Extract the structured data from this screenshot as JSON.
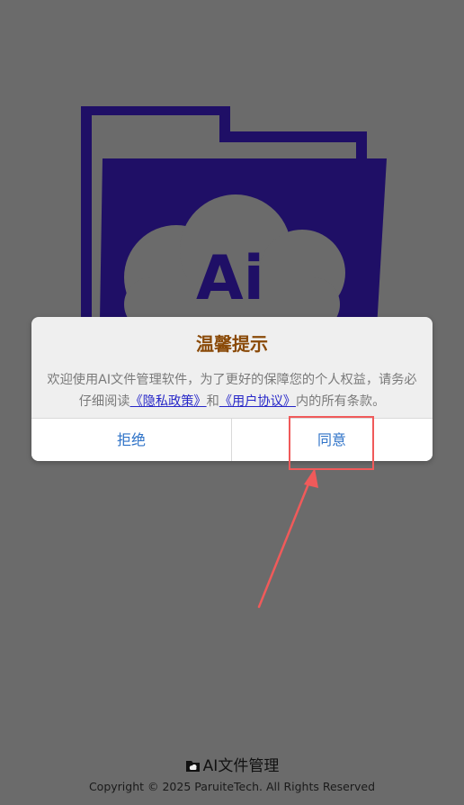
{
  "dialog": {
    "title": "温馨提示",
    "body_prefix": "欢迎使用AI文件管理软件，为了更好的保障您的个人权益，请务必仔细阅读",
    "privacy_link": "《隐私政策》",
    "body_middle": "和",
    "terms_link": "《用户协议》",
    "body_suffix": "内的所有条款。",
    "reject_label": "拒绝",
    "agree_label": "同意"
  },
  "splash": {
    "logo_text": "Ai",
    "logo_icon": "folder-cloud-icon"
  },
  "footer": {
    "app_icon": "folder-cloud-icon",
    "app_name": "AI文件管理",
    "copyright": "Copyright © 2025 ParuiteTech. All Rights Reserved"
  },
  "annotation": {
    "highlight_color": "#f05a5a"
  },
  "colors": {
    "overlay": "#6b6b6b",
    "folder": "#1f0f66",
    "title": "#8a4a08",
    "button_text": "#2f73c8",
    "link": "#2727c8"
  }
}
